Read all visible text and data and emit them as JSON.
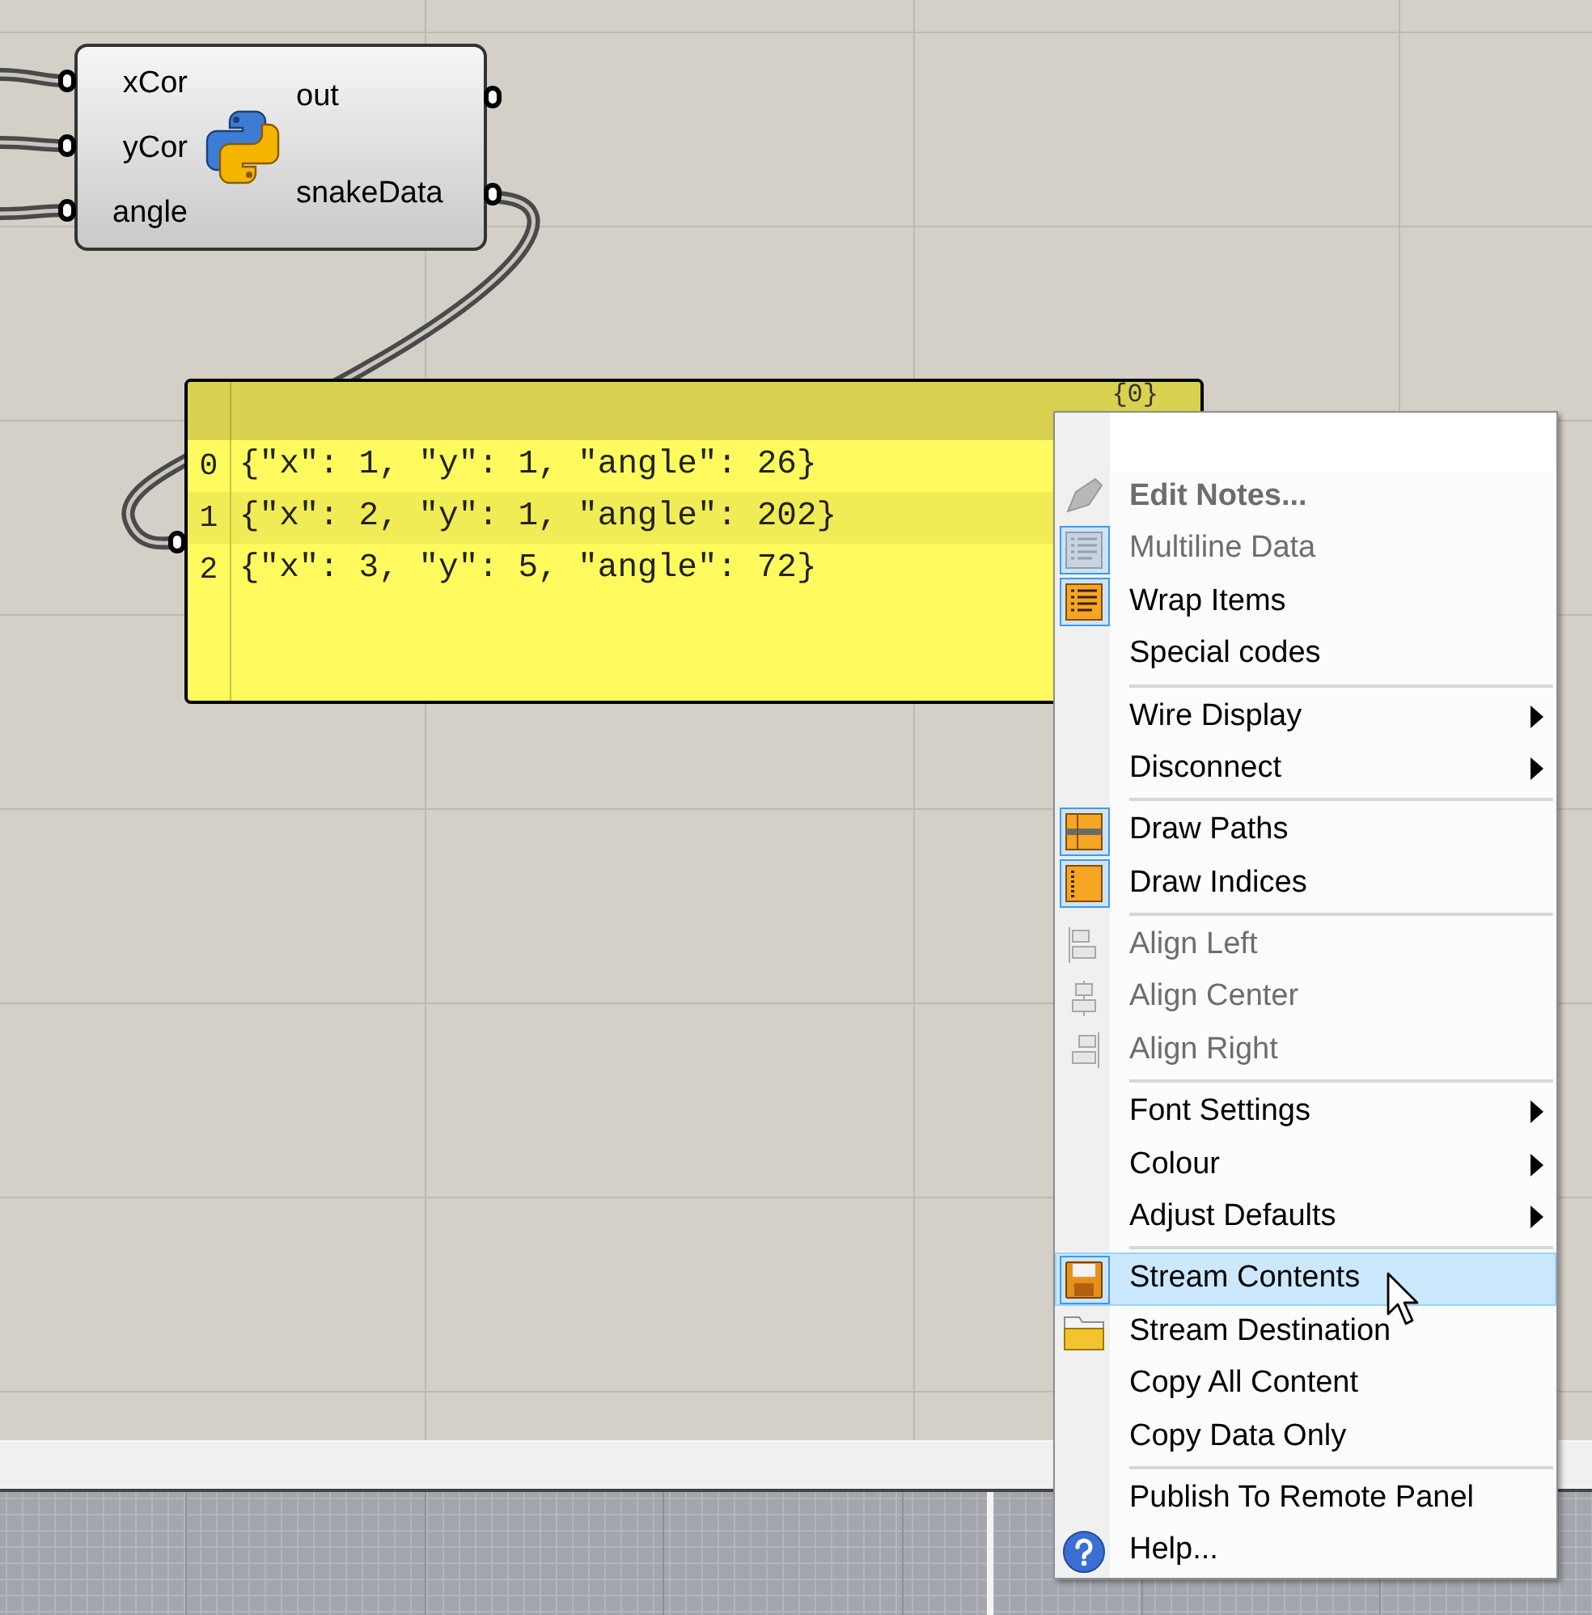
{
  "component": {
    "inputs": [
      {
        "name": "xCor"
      },
      {
        "name": "yCor"
      },
      {
        "name": "angle"
      }
    ],
    "outputs": [
      {
        "name": "out"
      },
      {
        "name": "snakeData"
      }
    ]
  },
  "panel": {
    "header": "{0}",
    "rows": [
      {
        "index": "0",
        "text": "{\"x\": 1, \"y\": 1, \"angle\": 26}"
      },
      {
        "index": "1",
        "text": "{\"x\": 2, \"y\": 1, \"angle\": 202}"
      },
      {
        "index": "2",
        "text": "{\"x\": 3, \"y\": 5, \"angle\": 72}"
      }
    ]
  },
  "context_menu": {
    "items": [
      {
        "kind": "item",
        "label": "Edit Notes...",
        "bold": true,
        "disabled": true,
        "checked": false,
        "submenu": false,
        "selected": false
      },
      {
        "kind": "item",
        "label": "Multiline Data",
        "bold": false,
        "disabled": true,
        "checked": true,
        "submenu": false,
        "selected": false
      },
      {
        "kind": "item",
        "label": "Wrap Items",
        "bold": false,
        "disabled": false,
        "checked": true,
        "submenu": false,
        "selected": false
      },
      {
        "kind": "item",
        "label": "Special codes",
        "bold": false,
        "disabled": false,
        "checked": false,
        "submenu": false,
        "selected": false
      },
      {
        "kind": "separator"
      },
      {
        "kind": "item",
        "label": "Wire Display",
        "bold": false,
        "disabled": false,
        "checked": false,
        "submenu": true,
        "selected": false
      },
      {
        "kind": "item",
        "label": "Disconnect",
        "bold": false,
        "disabled": false,
        "checked": false,
        "submenu": true,
        "selected": false
      },
      {
        "kind": "separator"
      },
      {
        "kind": "item",
        "label": "Draw Paths",
        "bold": false,
        "disabled": false,
        "checked": true,
        "submenu": false,
        "selected": false
      },
      {
        "kind": "item",
        "label": "Draw Indices",
        "bold": false,
        "disabled": false,
        "checked": true,
        "submenu": false,
        "selected": false
      },
      {
        "kind": "separator"
      },
      {
        "kind": "item",
        "label": "Align Left",
        "bold": false,
        "disabled": true,
        "checked": false,
        "submenu": false,
        "selected": false
      },
      {
        "kind": "item",
        "label": "Align Center",
        "bold": false,
        "disabled": true,
        "checked": false,
        "submenu": false,
        "selected": false
      },
      {
        "kind": "item",
        "label": "Align Right",
        "bold": false,
        "disabled": true,
        "checked": false,
        "submenu": false,
        "selected": false
      },
      {
        "kind": "separator"
      },
      {
        "kind": "item",
        "label": "Font Settings",
        "bold": false,
        "disabled": false,
        "checked": false,
        "submenu": true,
        "selected": false
      },
      {
        "kind": "item",
        "label": "Colour",
        "bold": false,
        "disabled": false,
        "checked": false,
        "submenu": true,
        "selected": false
      },
      {
        "kind": "item",
        "label": "Adjust Defaults",
        "bold": false,
        "disabled": false,
        "checked": false,
        "submenu": true,
        "selected": false
      },
      {
        "kind": "separator"
      },
      {
        "kind": "item",
        "label": "Stream Contents",
        "bold": false,
        "disabled": false,
        "checked": true,
        "submenu": false,
        "selected": true
      },
      {
        "kind": "item",
        "label": "Stream Destination",
        "bold": false,
        "disabled": false,
        "checked": false,
        "submenu": false,
        "selected": false
      },
      {
        "kind": "item",
        "label": "Copy All Content",
        "bold": false,
        "disabled": false,
        "checked": false,
        "submenu": false,
        "selected": false
      },
      {
        "kind": "item",
        "label": "Copy Data Only",
        "bold": false,
        "disabled": false,
        "checked": false,
        "submenu": false,
        "selected": false
      },
      {
        "kind": "separator"
      },
      {
        "kind": "item",
        "label": "Publish To Remote Panel",
        "bold": false,
        "disabled": false,
        "checked": false,
        "submenu": false,
        "selected": false
      },
      {
        "kind": "item",
        "label": "Help...",
        "bold": false,
        "disabled": false,
        "checked": false,
        "submenu": false,
        "selected": false
      }
    ]
  }
}
